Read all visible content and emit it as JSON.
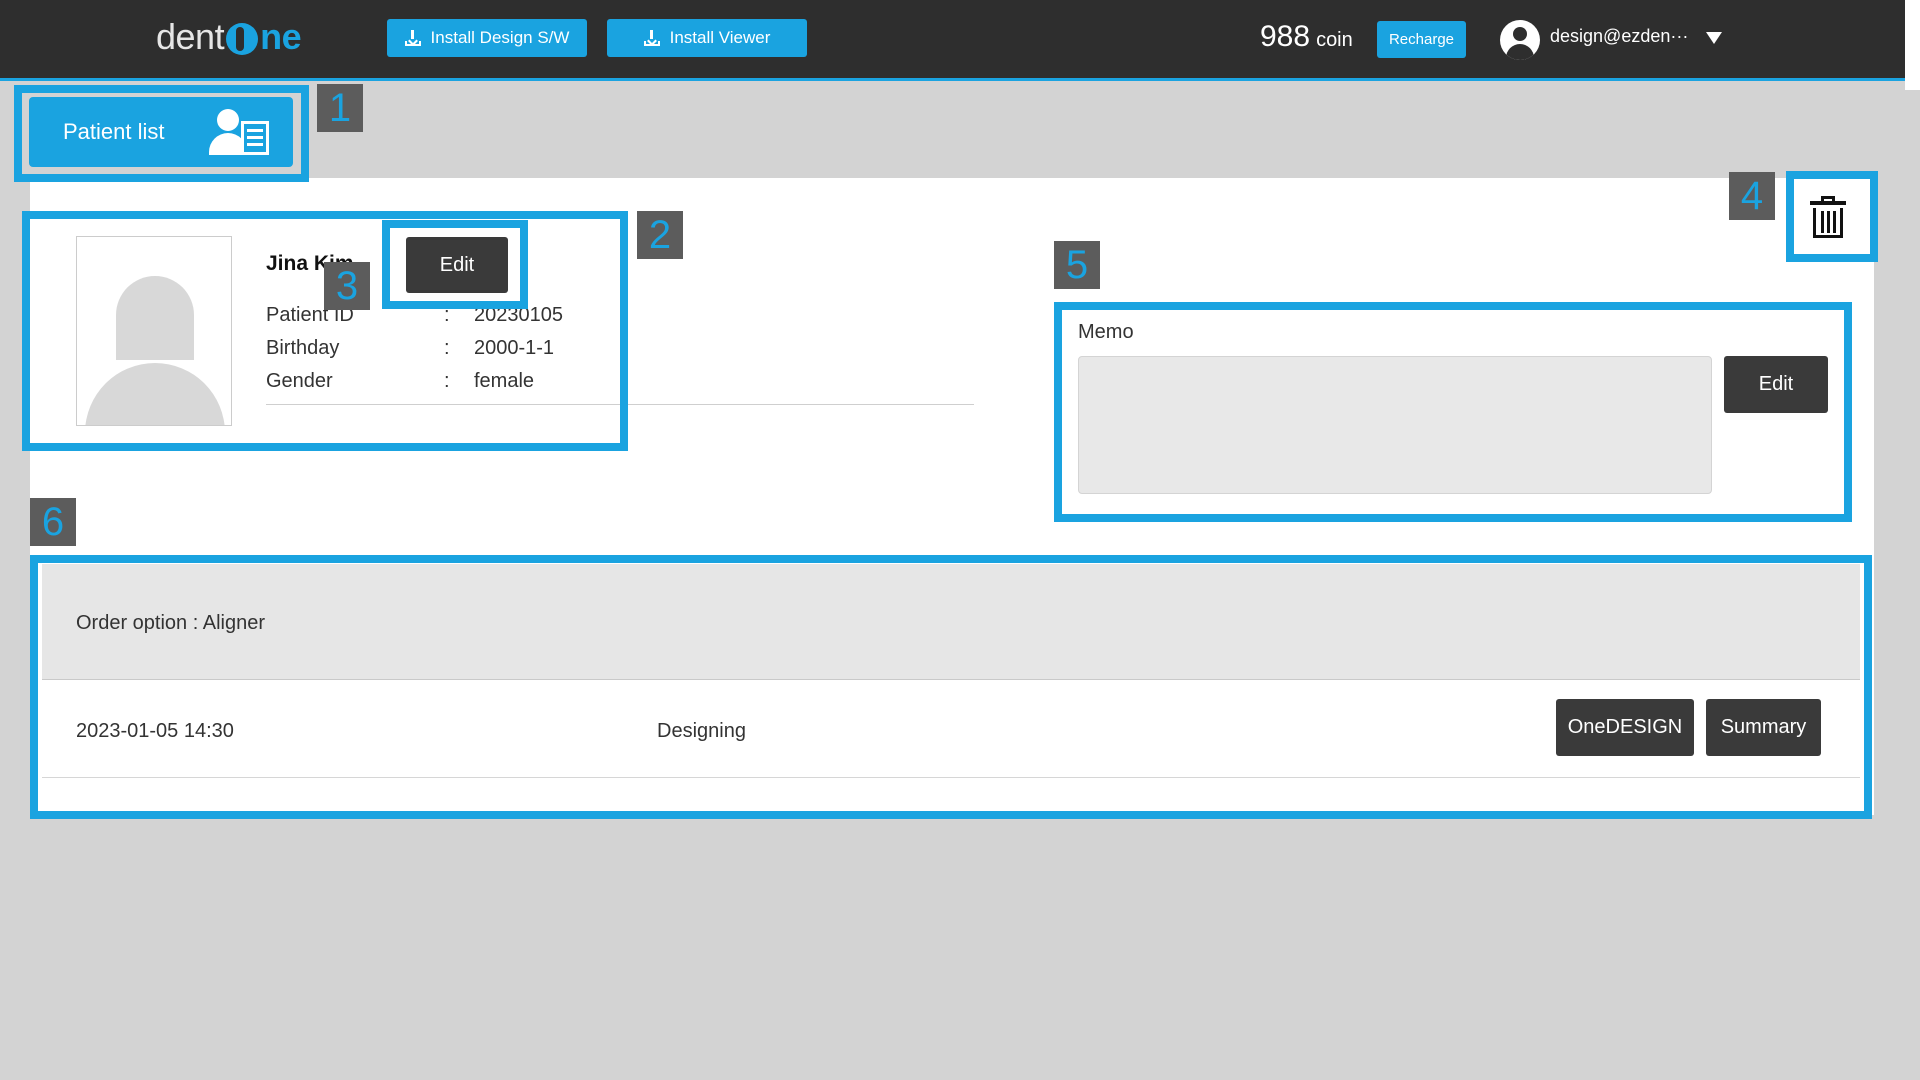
{
  "header": {
    "logo_left": "dent",
    "logo_right": "ne",
    "install_design_label": "Install Design S/W",
    "install_viewer_label": "Install Viewer",
    "coin_amount": "988",
    "coin_unit": "coin",
    "recharge_label": "Recharge",
    "user_email": "design@ezden···",
    "accent_color": "#1aa3e0"
  },
  "nav": {
    "patient_list_label": "Patient list"
  },
  "patient": {
    "name": "Jina Kim",
    "edit_label": "Edit",
    "fields": [
      {
        "label": "Patient ID",
        "sep": ":",
        "value": "20230105"
      },
      {
        "label": "Birthday",
        "sep": ":",
        "value": "2000-1-1"
      },
      {
        "label": "Gender",
        "sep": ":",
        "value": "female"
      }
    ]
  },
  "memo": {
    "label": "Memo",
    "value": "",
    "edit_label": "Edit"
  },
  "orders": {
    "option_title": "Order option : Aligner",
    "rows": [
      {
        "date": "2023-01-05 14:30",
        "status": "Designing",
        "design_button": "OneDESIGN",
        "summary_button": "Summary"
      }
    ]
  },
  "annotations": [
    "1",
    "2",
    "3",
    "4",
    "5",
    "6"
  ],
  "icons": [
    "download-icon",
    "user-avatar-icon",
    "caret-down-icon",
    "patient-list-icon",
    "trash-icon",
    "placeholder-photo"
  ]
}
